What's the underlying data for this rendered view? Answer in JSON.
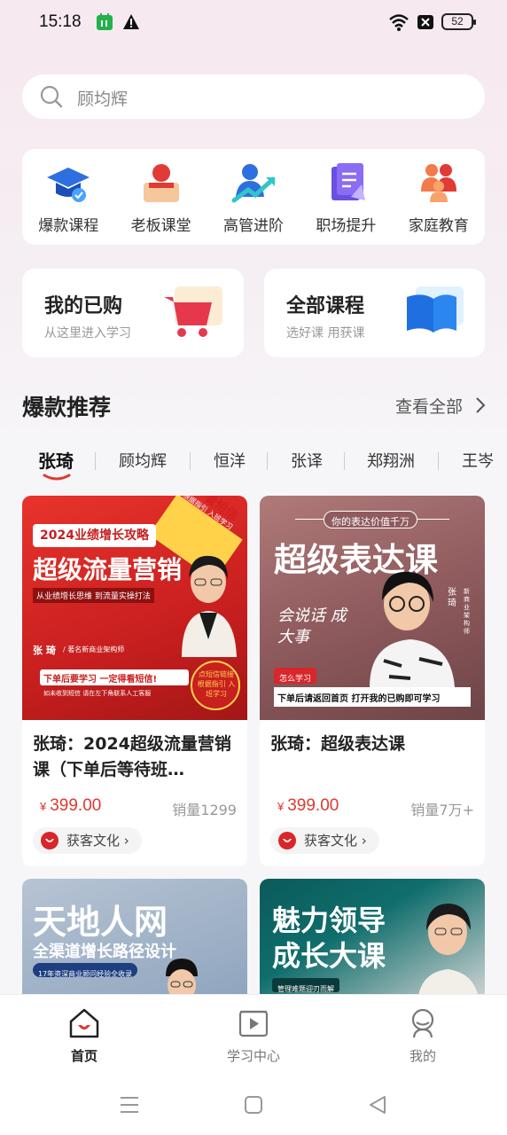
{
  "status_bar": {
    "time": "15:18",
    "battery": "52"
  },
  "search": {
    "placeholder": "顾均辉"
  },
  "categories": [
    {
      "label": "爆款课程",
      "icon": "graduation-cap-icon"
    },
    {
      "label": "老板课堂",
      "icon": "boss-lecture-icon"
    },
    {
      "label": "高管进阶",
      "icon": "executive-growth-icon"
    },
    {
      "label": "职场提升",
      "icon": "career-book-icon"
    },
    {
      "label": "家庭教育",
      "icon": "family-icon"
    }
  ],
  "my_purchased": {
    "title": "我的已购",
    "subtitle": "从这里进入学习"
  },
  "all_courses": {
    "title": "全部课程",
    "subtitle": "选好课 用获课"
  },
  "section": {
    "title": "爆款推荐",
    "see_all": "查看全部"
  },
  "teacher_tabs": [
    "张琦",
    "顾均辉",
    "恒洋",
    "张译",
    "郑翔洲",
    "王岑"
  ],
  "courses": [
    {
      "title": "张琦：2024超级流量营销课（下单后等待班…",
      "price": "399.00",
      "currency": "¥",
      "sales": "销量1299",
      "brand": "获客文化",
      "cover": {
        "tag": "2024业绩增长攻略",
        "headline": "超级流量营销",
        "sub": "从业绩增长思维 到流量实操打法",
        "author": "张 琦",
        "author_title": "/ 著名新商业架构师",
        "notice": "下单后要学习 一定得看短信!",
        "notice2": "如未收到短信 请在左下角联系人工客服",
        "corner": "看短信",
        "corner_sub": "根据指引 入班学习",
        "badge": "点短信链接 根据指引 入班学习"
      }
    },
    {
      "title": "张琦：超级表达课",
      "price": "399.00",
      "currency": "¥",
      "sales": "销量7万+",
      "brand": "获客文化",
      "cover": {
        "tag": "你的表达价值千万",
        "headline": "超级表达课",
        "script": "会说话 成大事",
        "author": "张琦",
        "author_title": "新商业架构师",
        "button": "怎么学习",
        "notice": "下单后请返回首页 打开我的已购即可学习"
      }
    },
    {
      "cover": {
        "headline": "天地人网",
        "sub": "全渠道增长路径设计",
        "tag": "17年资深商业顾问经验全收录"
      }
    },
    {
      "cover": {
        "headline1": "魅力领导",
        "headline2": "成长大课",
        "tag": "管理难题迎刃而解"
      }
    }
  ],
  "bottom_nav": [
    {
      "label": "首页",
      "icon": "home-icon",
      "active": true
    },
    {
      "label": "学习中心",
      "icon": "play-video-icon",
      "active": false
    },
    {
      "label": "我的",
      "icon": "profile-icon",
      "active": false
    }
  ]
}
